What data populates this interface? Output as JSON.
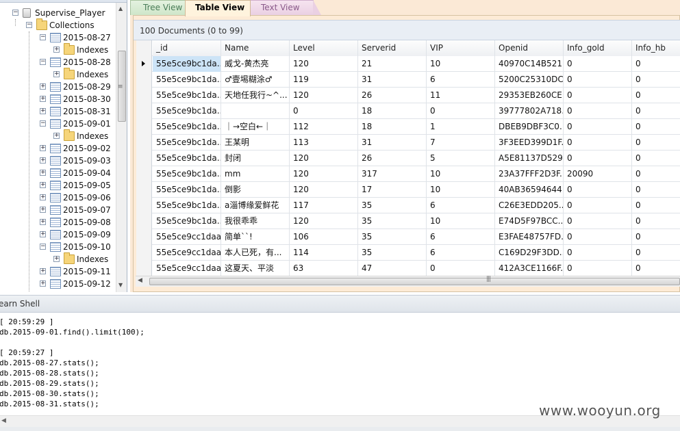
{
  "tree": {
    "db_name": "Supervise_Player",
    "collections_label": "Collections",
    "indexes_label": "Indexes",
    "items": [
      {
        "label": "2015-08-27",
        "expanded": true
      },
      {
        "label": "2015-08-28",
        "expanded": true
      },
      {
        "label": "2015-08-29",
        "expanded": false
      },
      {
        "label": "2015-08-30",
        "expanded": false
      },
      {
        "label": "2015-08-31",
        "expanded": false
      },
      {
        "label": "2015-09-01",
        "expanded": true
      },
      {
        "label": "2015-09-02",
        "expanded": false
      },
      {
        "label": "2015-09-03",
        "expanded": false
      },
      {
        "label": "2015-09-04",
        "expanded": false
      },
      {
        "label": "2015-09-05",
        "expanded": false
      },
      {
        "label": "2015-09-06",
        "expanded": false
      },
      {
        "label": "2015-09-07",
        "expanded": false
      },
      {
        "label": "2015-09-08",
        "expanded": false
      },
      {
        "label": "2015-09-09",
        "expanded": false
      },
      {
        "label": "2015-09-10",
        "expanded": true
      },
      {
        "label": "2015-09-11",
        "expanded": false
      },
      {
        "label": "2015-09-12",
        "expanded": false
      }
    ]
  },
  "tabs": {
    "tree_view": "Tree View",
    "table_view": "Table View",
    "text_view": "Text View"
  },
  "doc_count_label": "100 Documents (0 to 99)",
  "table": {
    "columns": [
      "_id",
      "Name",
      "Level",
      "Serverid",
      "VIP",
      "Openid",
      "Info_gold",
      "Info_hb"
    ],
    "rows": [
      [
        "55e5ce9bc1da...",
        "威戈-黄杰亮",
        "120",
        "21",
        "10",
        "40970C14B521...",
        "0",
        "0"
      ],
      [
        "55e5ce9bc1da...",
        "♂壹埸糊涂♂",
        "119",
        "31",
        "6",
        "5200C25310DC...",
        "0",
        "0"
      ],
      [
        "55e5ce9bc1da...",
        "天地任我行~^...",
        "120",
        "26",
        "11",
        "29353EB260CE...",
        "0",
        "0"
      ],
      [
        "55e5ce9bc1da...",
        "",
        "0",
        "18",
        "0",
        "39777802A718...",
        "0",
        "0"
      ],
      [
        "55e5ce9bc1da...",
        "｜→空白←｜",
        "112",
        "18",
        "1",
        "DBEB9DBF3C0...",
        "0",
        "0"
      ],
      [
        "55e5ce9bc1da...",
        "王某明",
        "113",
        "31",
        "7",
        "3F3EED399D1F...",
        "0",
        "0"
      ],
      [
        "55e5ce9bc1da...",
        "封闭",
        "120",
        "26",
        "5",
        "A5E81137D529...",
        "0",
        "0"
      ],
      [
        "55e5ce9bc1da...",
        "  mm",
        "120",
        "317",
        "10",
        "23A37FFF2D3F...",
        "20090",
        "0"
      ],
      [
        "55e5ce9bc1da...",
        "倒影",
        "120",
        "17",
        "10",
        "40AB36594644...",
        "0",
        "0"
      ],
      [
        "55e5ce9bc1da...",
        "a淄博缘爱鲜花",
        "117",
        "35",
        "6",
        "C26E3EDD205...",
        "0",
        "0"
      ],
      [
        "55e5ce9bc1da...",
        "我很乖乖",
        "120",
        "35",
        "10",
        "E74D5F97BCC...",
        "0",
        "0"
      ],
      [
        "55e5ce9cc1daa...",
        "简单``!",
        "106",
        "35",
        "6",
        "E3FAE48757FD...",
        "0",
        "0"
      ],
      [
        "55e5ce9cc1daa...",
        "本人已死，有...",
        "114",
        "35",
        "6",
        "C169D29F3DD...",
        "0",
        "0"
      ],
      [
        "55e5ce9cc1daa...",
        "这夏天、平淡",
        "63",
        "47",
        "0",
        "412A3CE1166F...",
        "0",
        "0"
      ]
    ]
  },
  "shell": {
    "title": "earn Shell",
    "lines": [
      "[ 20:59:29 ]",
      "db.2015-09-01.find().limit(100);",
      "",
      "[ 20:59:27 ]",
      "db.2015-08-27.stats();",
      "db.2015-08-28.stats();",
      "db.2015-08-29.stats();",
      "db.2015-08-30.stats();",
      "db.2015-08-31.stats();"
    ]
  },
  "watermark": "www.wooyun.org"
}
